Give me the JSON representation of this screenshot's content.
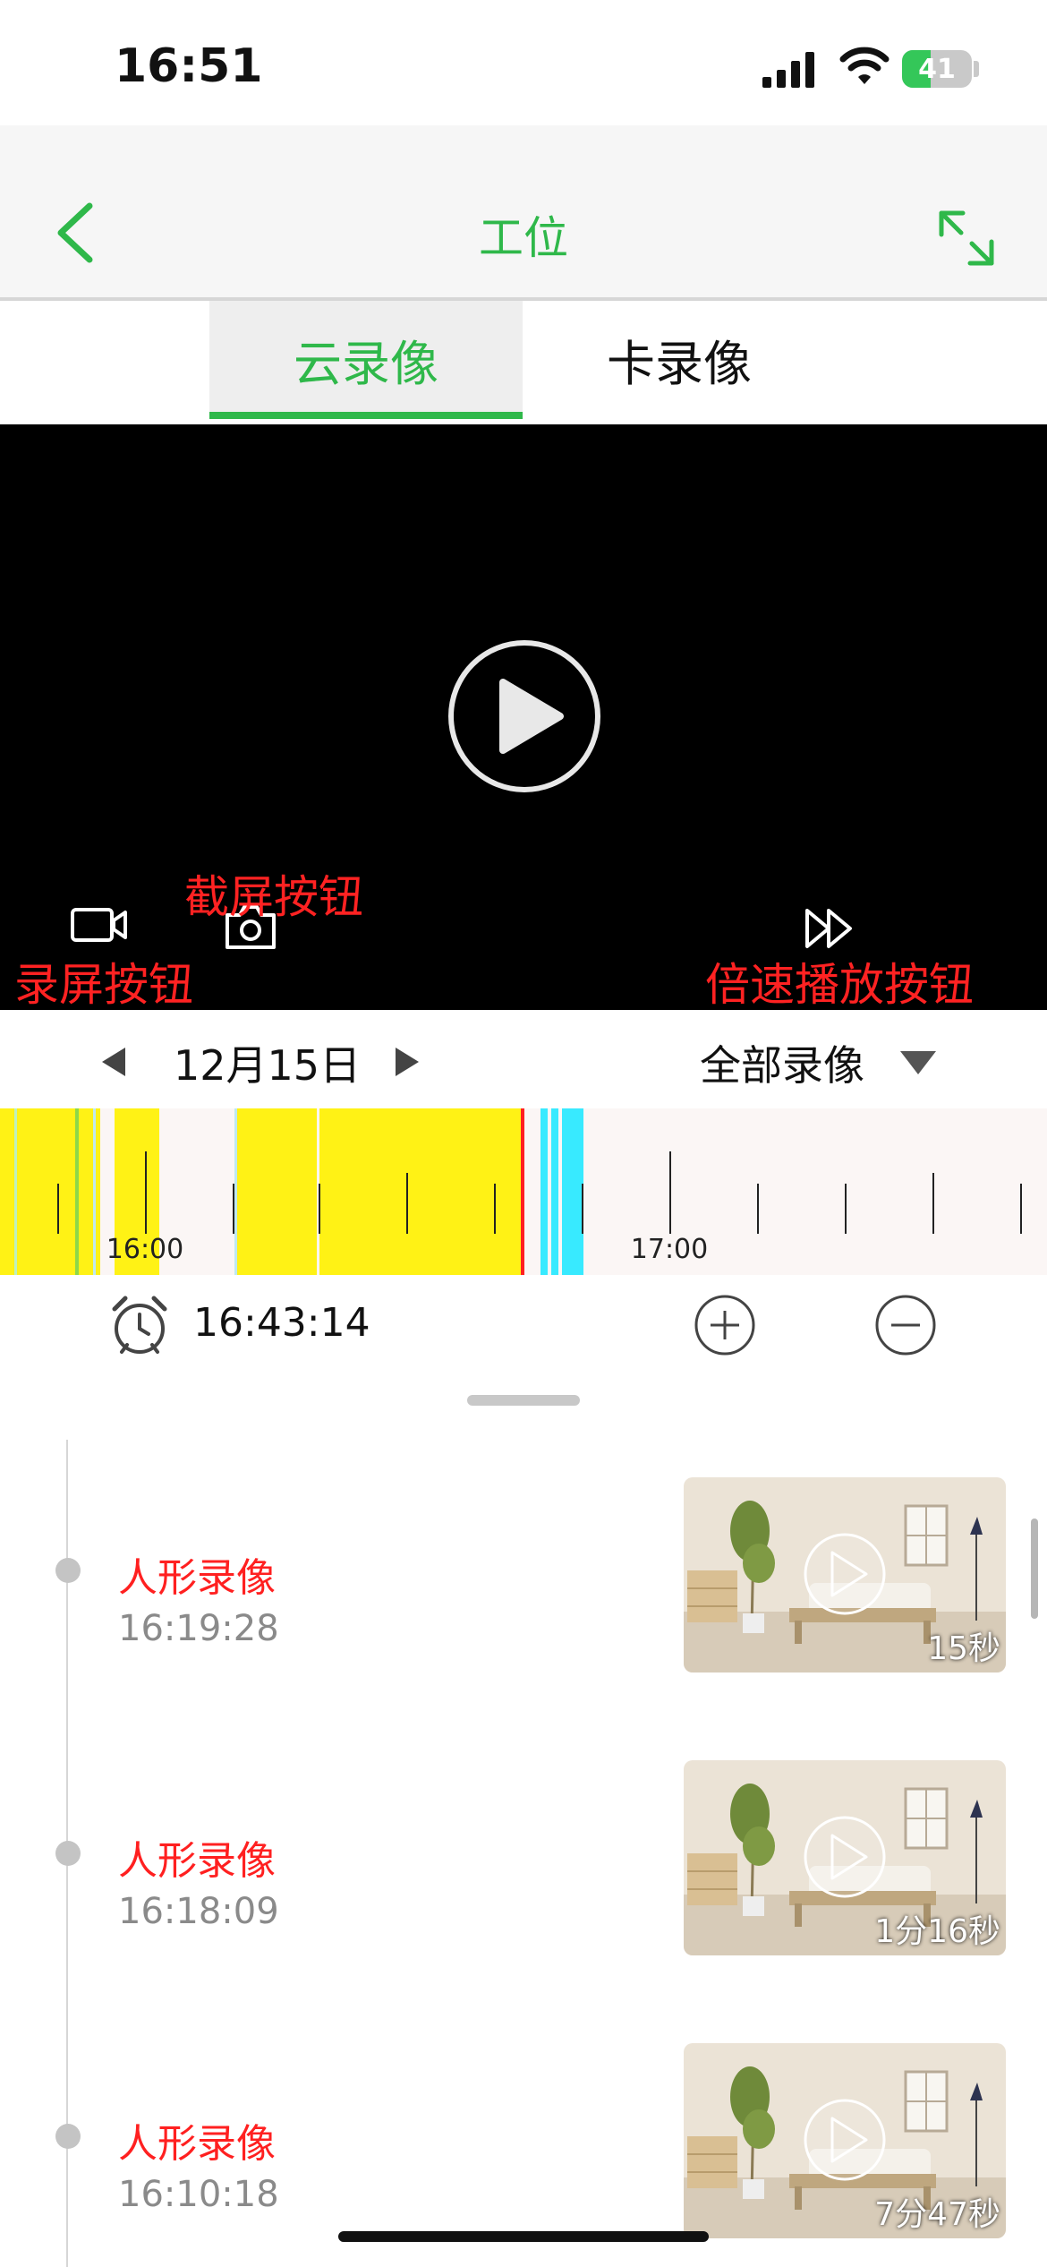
{
  "status_bar": {
    "time": "16:51",
    "battery": "41"
  },
  "nav": {
    "title": "工位"
  },
  "tabs": [
    {
      "label": "云录像",
      "active": true
    },
    {
      "label": "卡录像",
      "active": false
    }
  ],
  "player": {
    "annotations": {
      "record": "录屏按钮",
      "screenshot": "截屏按钮",
      "speed": "倍速播放按钮"
    }
  },
  "date_row": {
    "date": "12月15日",
    "filter": "全部录像"
  },
  "timeline": {
    "labels": [
      "16:00",
      "17:00"
    ]
  },
  "time_row": {
    "current_time": "16:43:14"
  },
  "colors": {
    "accent": "#2fb84a",
    "annotation_red": "#ff2222",
    "timeline_yellow": "#fff215",
    "timeline_cyan": "#38eaff",
    "timeline_bg": "#fbf6f5",
    "event_red": "#ff2020"
  },
  "records": [
    {
      "title": "人形录像",
      "time": "16:19:28",
      "duration": "15秒"
    },
    {
      "title": "人形录像",
      "time": "16:18:09",
      "duration": "1分16秒"
    },
    {
      "title": "人形录像",
      "time": "16:10:18",
      "duration": "7分47秒"
    }
  ]
}
